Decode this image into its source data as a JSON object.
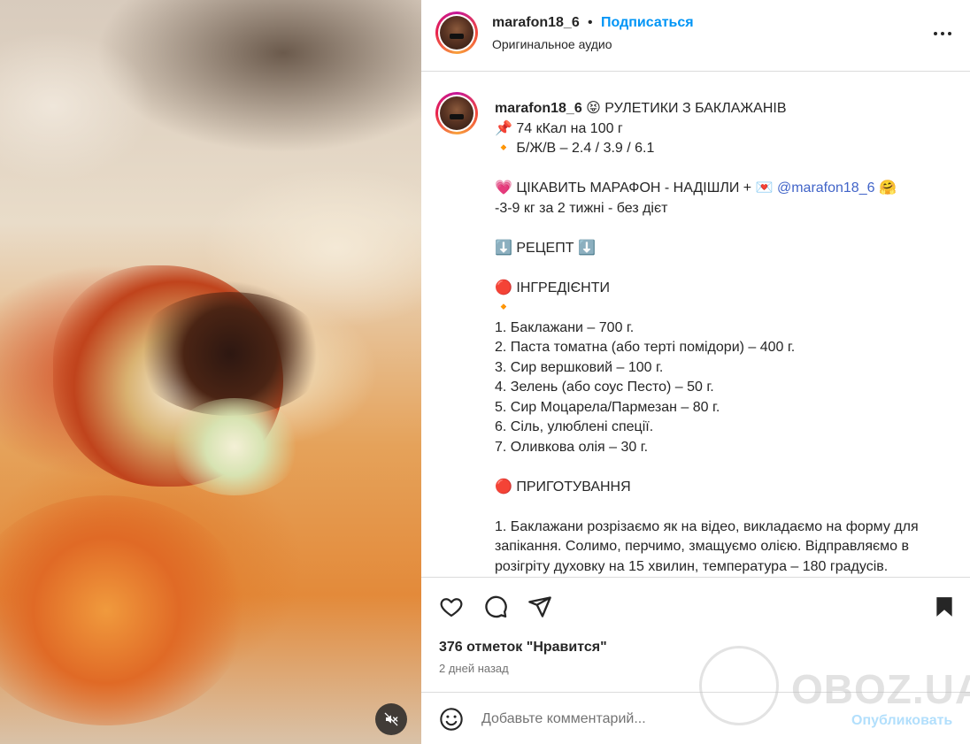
{
  "header": {
    "username": "marafon18_6",
    "separator": "•",
    "follow_label": "Подписаться",
    "audio_label": "Оригинальное аудио"
  },
  "caption": {
    "username": "marafon18_6",
    "lines": {
      "l1": "😝 РУЛЕТИКИ З БАКЛАЖАНІВ",
      "l2": "📌 74 кКал на 100 г",
      "l3": "🔸 Б/Ж/В – 2.4 / 3.9 / 6.1",
      "l4a": "💗 ЦІКАВИТЬ МАРАФОН - НАДІШЛИ + 💌 ",
      "l4_mention": "@marafon18_6",
      "l4b": " 🤗",
      "l5": "-3-9 кг за 2 тижні - без дієт",
      "l6": "⬇️ РЕЦЕПТ ⬇️",
      "l7": "🔴 ІНГРЕДІЄНТИ",
      "l8": "🔸",
      "l9": "1. Баклажани – 700 г.",
      "l10": "2. Паста томатна (або терті помідори) – 400 г.",
      "l11": "3. Сир вершковий – 100 г.",
      "l12": "4. Зелень (або соус Песто) – 50 г.",
      "l13": "5. Сир Моцарела/Пармезан – 80 г.",
      "l14": "6. Сіль, улюблені спеції.",
      "l15": "7. Оливкова олія – 30 г.",
      "l16": "🔴 ПРИГОТУВАННЯ",
      "l17": "1. Баклажани розрізаємо як на відео, викладаємо на форму для запікання. Солимо, перчимо, змащуємо олією. Відправляємо в розігріту духовку на 15 хвилин, температура – 180 градусів."
    }
  },
  "actions": {
    "likes": "376 отметок \"Нравится\"",
    "date": "2 дней назад"
  },
  "comment": {
    "placeholder": "Добавьте комментарий...",
    "post_label": "Опубликовать"
  },
  "watermark": {
    "text": "OBOZ.UA"
  },
  "colors": {
    "accent": "#0095f6",
    "mention": "#4164c8",
    "border": "#dbdbdb",
    "muted": "#737373"
  },
  "icons": [
    "volume-off-icon",
    "more-icon",
    "heart-icon",
    "comment-icon",
    "share-icon",
    "bookmark-icon",
    "emoji-icon"
  ]
}
